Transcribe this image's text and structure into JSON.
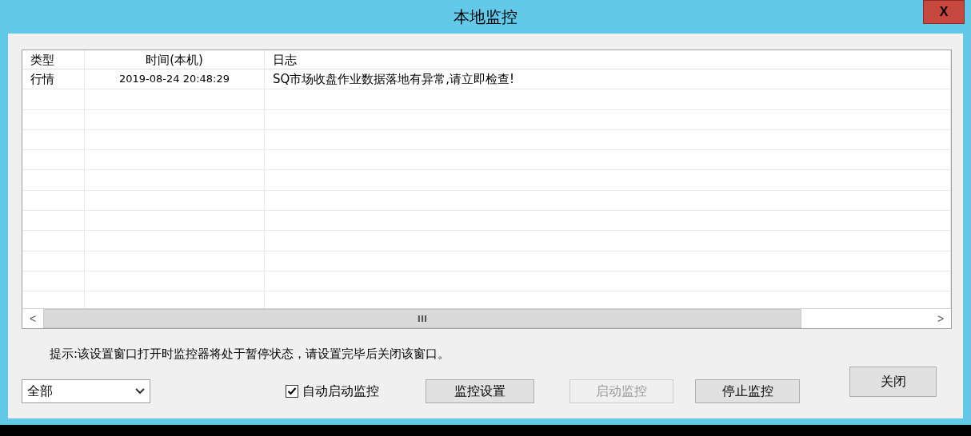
{
  "window": {
    "title": "本地监控",
    "close_label": "X"
  },
  "table": {
    "columns": [
      "类型",
      "时间(本机)",
      "日志"
    ],
    "rows": [
      {
        "cells": [
          "行情",
          "2019-08-24 20:48:29",
          "SQ市场收盘作业数据落地有异常,请立即检查!"
        ]
      }
    ],
    "scrollbar": {
      "left": "<",
      "grip": "III",
      "right": ">"
    }
  },
  "hint": "提示:该设置窗口打开时监控器将处于暂停状态，请设置完毕后关闭该窗口。",
  "filter": {
    "value": "全部"
  },
  "auto_start": {
    "label": "自动启动监控",
    "checked": true
  },
  "buttons": [
    {
      "label": "监控设置",
      "disabled": false
    },
    {
      "label": "启动监控",
      "disabled": true
    },
    {
      "label": "停止监控",
      "disabled": false
    }
  ],
  "close_button": {
    "label": "关闭"
  }
}
